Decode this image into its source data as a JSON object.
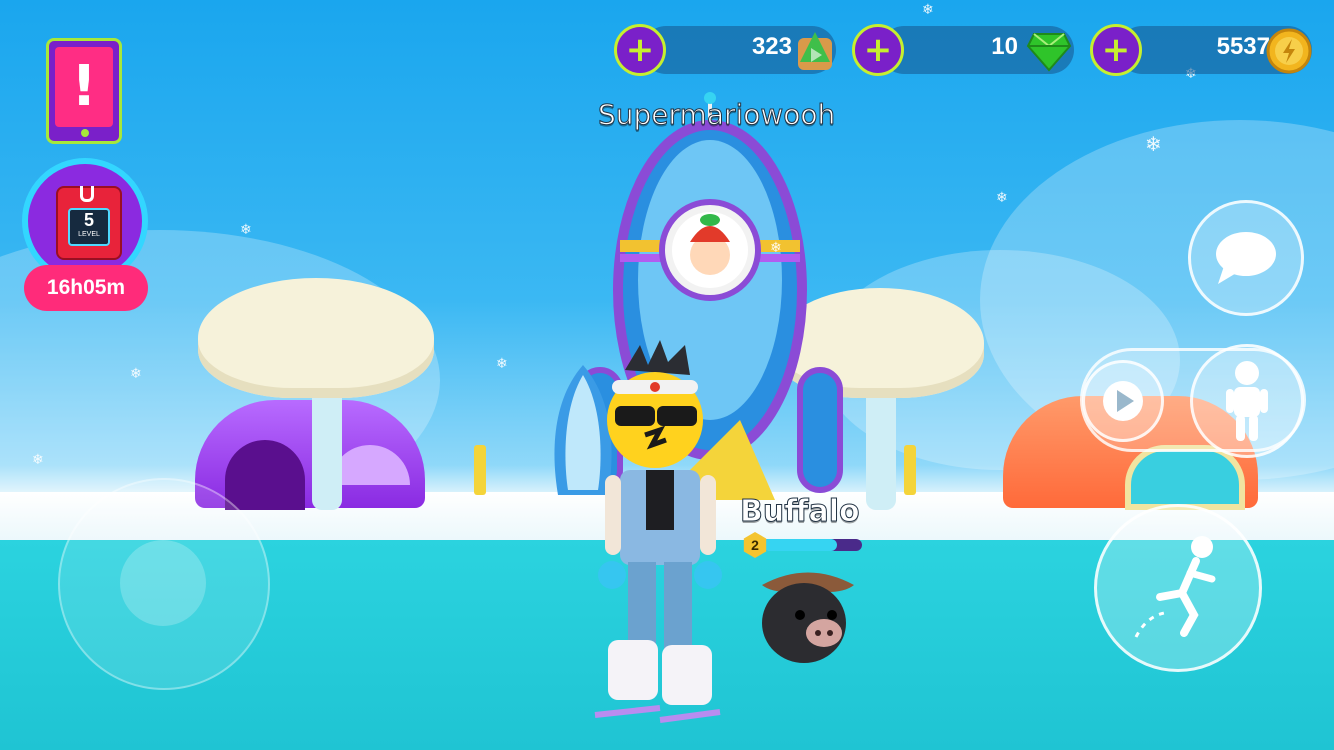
{
  "hud": {
    "currencies": [
      {
        "id": "trees",
        "value": "323",
        "add_label": "+",
        "icon": "tree-ticket-icon"
      },
      {
        "id": "gems",
        "value": "10",
        "add_label": "+",
        "icon": "green-gem-icon"
      },
      {
        "id": "coins",
        "value": "5537",
        "add_label": "+",
        "icon": "gold-coin-icon"
      }
    ],
    "alert_label": "!",
    "chest": {
      "level": "5",
      "level_label": "LEVEL",
      "timer": "16h05m"
    }
  },
  "world": {
    "player_name": "Supermariowooh",
    "pet_name": "Buffalo",
    "pet_level": "2",
    "pet_xp_fraction": 0.75
  },
  "controls": {
    "chat_icon": "speech-bubble-icon",
    "emote_icon": "avatar-emote-icon",
    "play_icon": "play-triangle-icon",
    "jump_icon": "jump-runner-icon",
    "joystick": "movement-joystick"
  },
  "colors": {
    "accent_purple": "#7a20c9",
    "accent_lime": "#c6ef2f",
    "timer_pink": "#ff2b7a"
  }
}
